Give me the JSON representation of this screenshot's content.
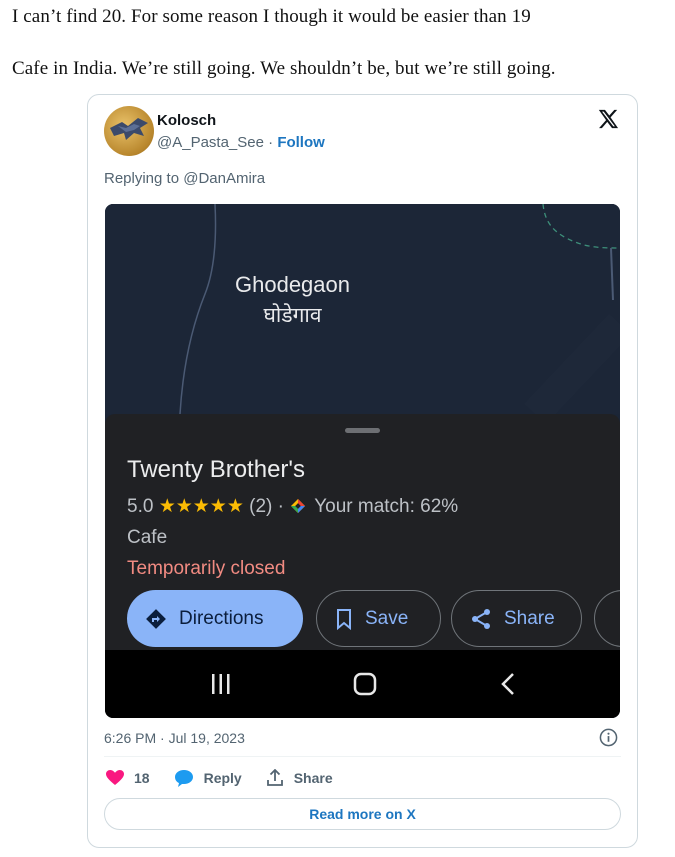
{
  "intro": {
    "line1": "I can’t find 20. For some reason I though it would be easier than 19",
    "line2": "Cafe in India. We’re still going. We shouldn’t be, but we’re still going."
  },
  "tweet": {
    "author_name": "Kolosch",
    "handle": "@A_Pasta_See",
    "separator": " · ",
    "follow_label": "Follow",
    "replying_to": "Replying to @DanAmira",
    "timestamp": "6:26 PM · Jul 19, 2023",
    "likes": "18",
    "reply_label": "Reply",
    "share_label": "Share",
    "read_more_label": "Read more on X",
    "like_color": "#f91880",
    "link_color": "#1d76c0"
  },
  "screenshot": {
    "map_label_en": "Ghodegaon",
    "map_label_hi": "घोडेगाव",
    "place_name": "Twenty Brother's",
    "rating": "5.0",
    "stars": "★★★★★",
    "review_count": "(2) ·",
    "match_text": "Your match: 62%",
    "category": "Cafe",
    "status": "Temporarily closed",
    "status_color": "#f28b82",
    "buttons": {
      "directions": "Directions",
      "save": "Save",
      "share": "Share"
    },
    "icons": [
      "directions-icon",
      "bookmark-icon",
      "share-icon",
      "recents-icon",
      "home-icon",
      "back-icon"
    ]
  }
}
